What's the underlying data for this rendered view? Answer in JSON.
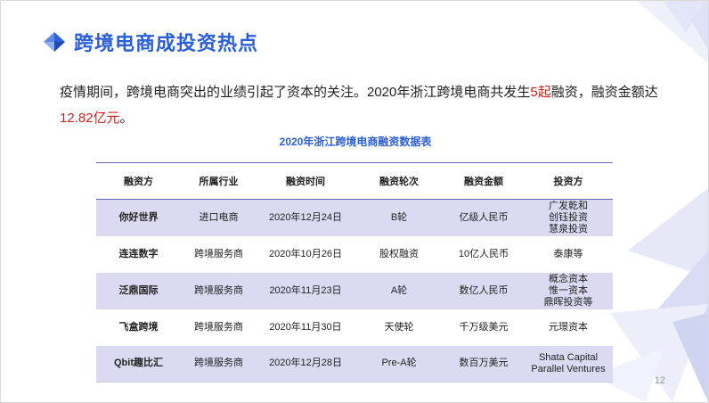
{
  "slide": {
    "title": "跨境电商成投资热点",
    "paragraph": {
      "pre1": "疫情期间，跨境电商突出的业绩引起了资本的关注。2020年浙江跨境电商共发生",
      "hl1": "5起",
      "mid": "融资，融资金额达",
      "hl2": "12.82亿元",
      "end": "。"
    },
    "table_title": "2020年浙江跨境电商融资数据表",
    "table": {
      "headers": [
        "融资方",
        "所属行业",
        "融资时间",
        "融资轮次",
        "融资金额",
        "投资方"
      ],
      "rows": [
        {
          "c0": "你好世界",
          "c1": "进口电商",
          "c2": "2020年12月24日",
          "c3": "B轮",
          "c4": "亿级人民币",
          "inv": [
            "广发乾和",
            "创钰投资",
            "慧泉投资"
          ]
        },
        {
          "c0": "连连数字",
          "c1": "跨境服务商",
          "c2": "2020年10月26日",
          "c3": "股权融资",
          "c4": "10亿人民币",
          "inv": [
            "泰康等"
          ]
        },
        {
          "c0": "泛鼎国际",
          "c1": "跨境服务商",
          "c2": "2020年11月23日",
          "c3": "A轮",
          "c4": "数亿人民币",
          "inv": [
            "概念资本",
            "惟一资本",
            "鼎晖投资等"
          ]
        },
        {
          "c0": "飞盒跨境",
          "c1": "跨境服务商",
          "c2": "2020年11月30日",
          "c3": "天使轮",
          "c4": "千万级美元",
          "inv": [
            "元璟资本"
          ]
        },
        {
          "c0": "Qbit趣比汇",
          "c1": "跨境服务商",
          "c2": "2020年12月28日",
          "c3": "Pre-A轮",
          "c4": "数百万美元",
          "inv": [
            "Shata Capital",
            "Parallel Ventures"
          ]
        }
      ]
    },
    "page_number": "12"
  }
}
